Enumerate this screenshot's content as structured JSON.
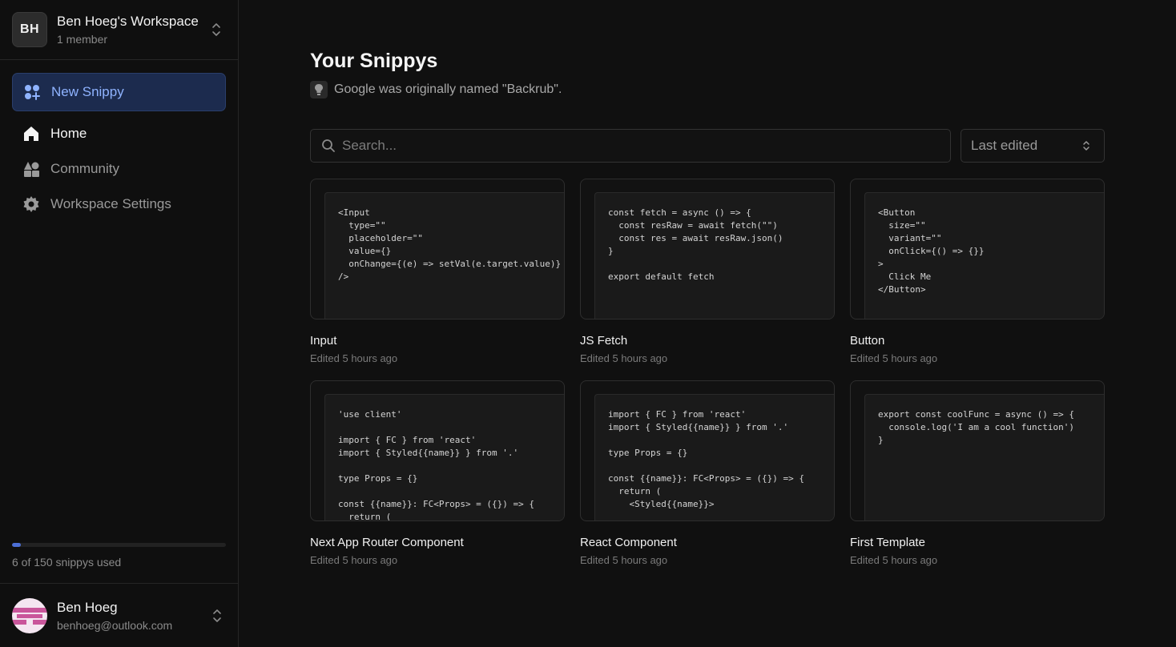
{
  "workspace": {
    "initials": "BH",
    "name": "Ben Hoeg's Workspace",
    "members": "1 member"
  },
  "sidebar": {
    "new_button": "New Snippy",
    "items": [
      {
        "label": "Home",
        "active": true
      },
      {
        "label": "Community",
        "active": false
      },
      {
        "label": "Workspace Settings",
        "active": false
      }
    ],
    "usage": {
      "text": "6 of 150 snippys used",
      "used": 6,
      "total": 150
    }
  },
  "user": {
    "name": "Ben Hoeg",
    "email": "benhoeg@outlook.com"
  },
  "main": {
    "title": "Your Snippys",
    "fact": "Google was originally named \"Backrub\".",
    "search_placeholder": "Search...",
    "sort_value": "Last edited"
  },
  "snippets": [
    {
      "title": "Input",
      "edited": "Edited 5 hours ago",
      "code": "<Input\n  type=\"\"\n  placeholder=\"\"\n  value={}\n  onChange={(e) => setVal(e.target.value)}\n/>"
    },
    {
      "title": "JS Fetch",
      "edited": "Edited 5 hours ago",
      "code": "const fetch = async () => {\n  const resRaw = await fetch(\"\")\n  const res = await resRaw.json()\n}\n\nexport default fetch"
    },
    {
      "title": "Button",
      "edited": "Edited 5 hours ago",
      "code": "<Button\n  size=\"\"\n  variant=\"\"\n  onClick={() => {}}\n>\n  Click Me\n</Button>"
    },
    {
      "title": "Next App Router Component",
      "edited": "Edited 5 hours ago",
      "code": "'use client'\n\nimport { FC } from 'react'\nimport { Styled{{name}} } from '.'\n\ntype Props = {}\n\nconst {{name}}: FC<Props> = ({}) => {\n  return ("
    },
    {
      "title": "React Component",
      "edited": "Edited 5 hours ago",
      "code": "import { FC } from 'react'\nimport { Styled{{name}} } from '.'\n\ntype Props = {}\n\nconst {{name}}: FC<Props> = ({}) => {\n  return (\n    <Styled{{name}}>"
    },
    {
      "title": "First Template",
      "edited": "Edited 5 hours ago",
      "code": "export const coolFunc = async () => {\n  console.log('I am a cool function')\n}"
    }
  ],
  "colors": {
    "accent": "#4c6fd6",
    "new_button_bg": "#1c2b4e",
    "new_button_text": "#8fb3ff",
    "background": "#101010"
  }
}
